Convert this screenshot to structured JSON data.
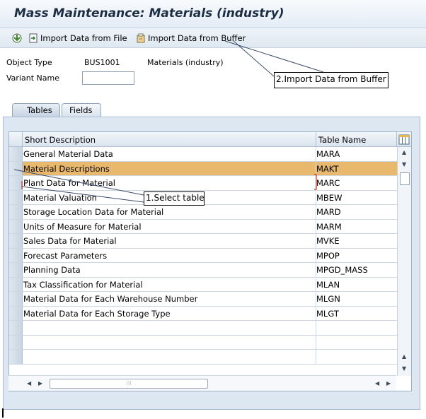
{
  "title": "Mass Maintenance: Materials (industry)",
  "toolbar": {
    "import_file_label": "Import Data from File",
    "import_buffer_label": "Import Data from Buffer"
  },
  "fields": {
    "object_type_label": "Object Type",
    "object_type_value": "BUS1001",
    "object_type_desc": "Materials (industry)",
    "variant_name_label": "Variant Name",
    "variant_name_value": ""
  },
  "tabs": [
    "Tables",
    "Fields"
  ],
  "table": {
    "headers": {
      "desc": "Short Description",
      "name": "Table Name"
    },
    "rows": [
      {
        "desc": "General Material Data",
        "name": "MARA"
      },
      {
        "desc": "Material Descriptions",
        "name": "MAKT"
      },
      {
        "desc": "Plant Data for Material",
        "name": "MARC"
      },
      {
        "desc": "Material Valuation",
        "name": "MBEW"
      },
      {
        "desc": "Storage Location Data for Material",
        "name": "MARD"
      },
      {
        "desc": "Units of Measure for Material",
        "name": "MARM"
      },
      {
        "desc": "Sales Data for Material",
        "name": "MVKE"
      },
      {
        "desc": "Forecast Parameters",
        "name": "MPOP"
      },
      {
        "desc": "Planning Data",
        "name": "MPGD_MASS"
      },
      {
        "desc": "Tax Classification for Material",
        "name": "MLAN"
      },
      {
        "desc": "Material Data for Each Warehouse Number",
        "name": "MLGN"
      },
      {
        "desc": "Material Data for Each Storage Type",
        "name": "MLGT"
      }
    ],
    "selected_row": 1
  },
  "callouts": {
    "import_buffer": "2.Import Data from Buffer",
    "select_table": "1.Select table"
  },
  "colors": {
    "selected_row": "#e8b86d",
    "panel_bg": "#dde7f1",
    "title_text": "#1c2d44"
  }
}
